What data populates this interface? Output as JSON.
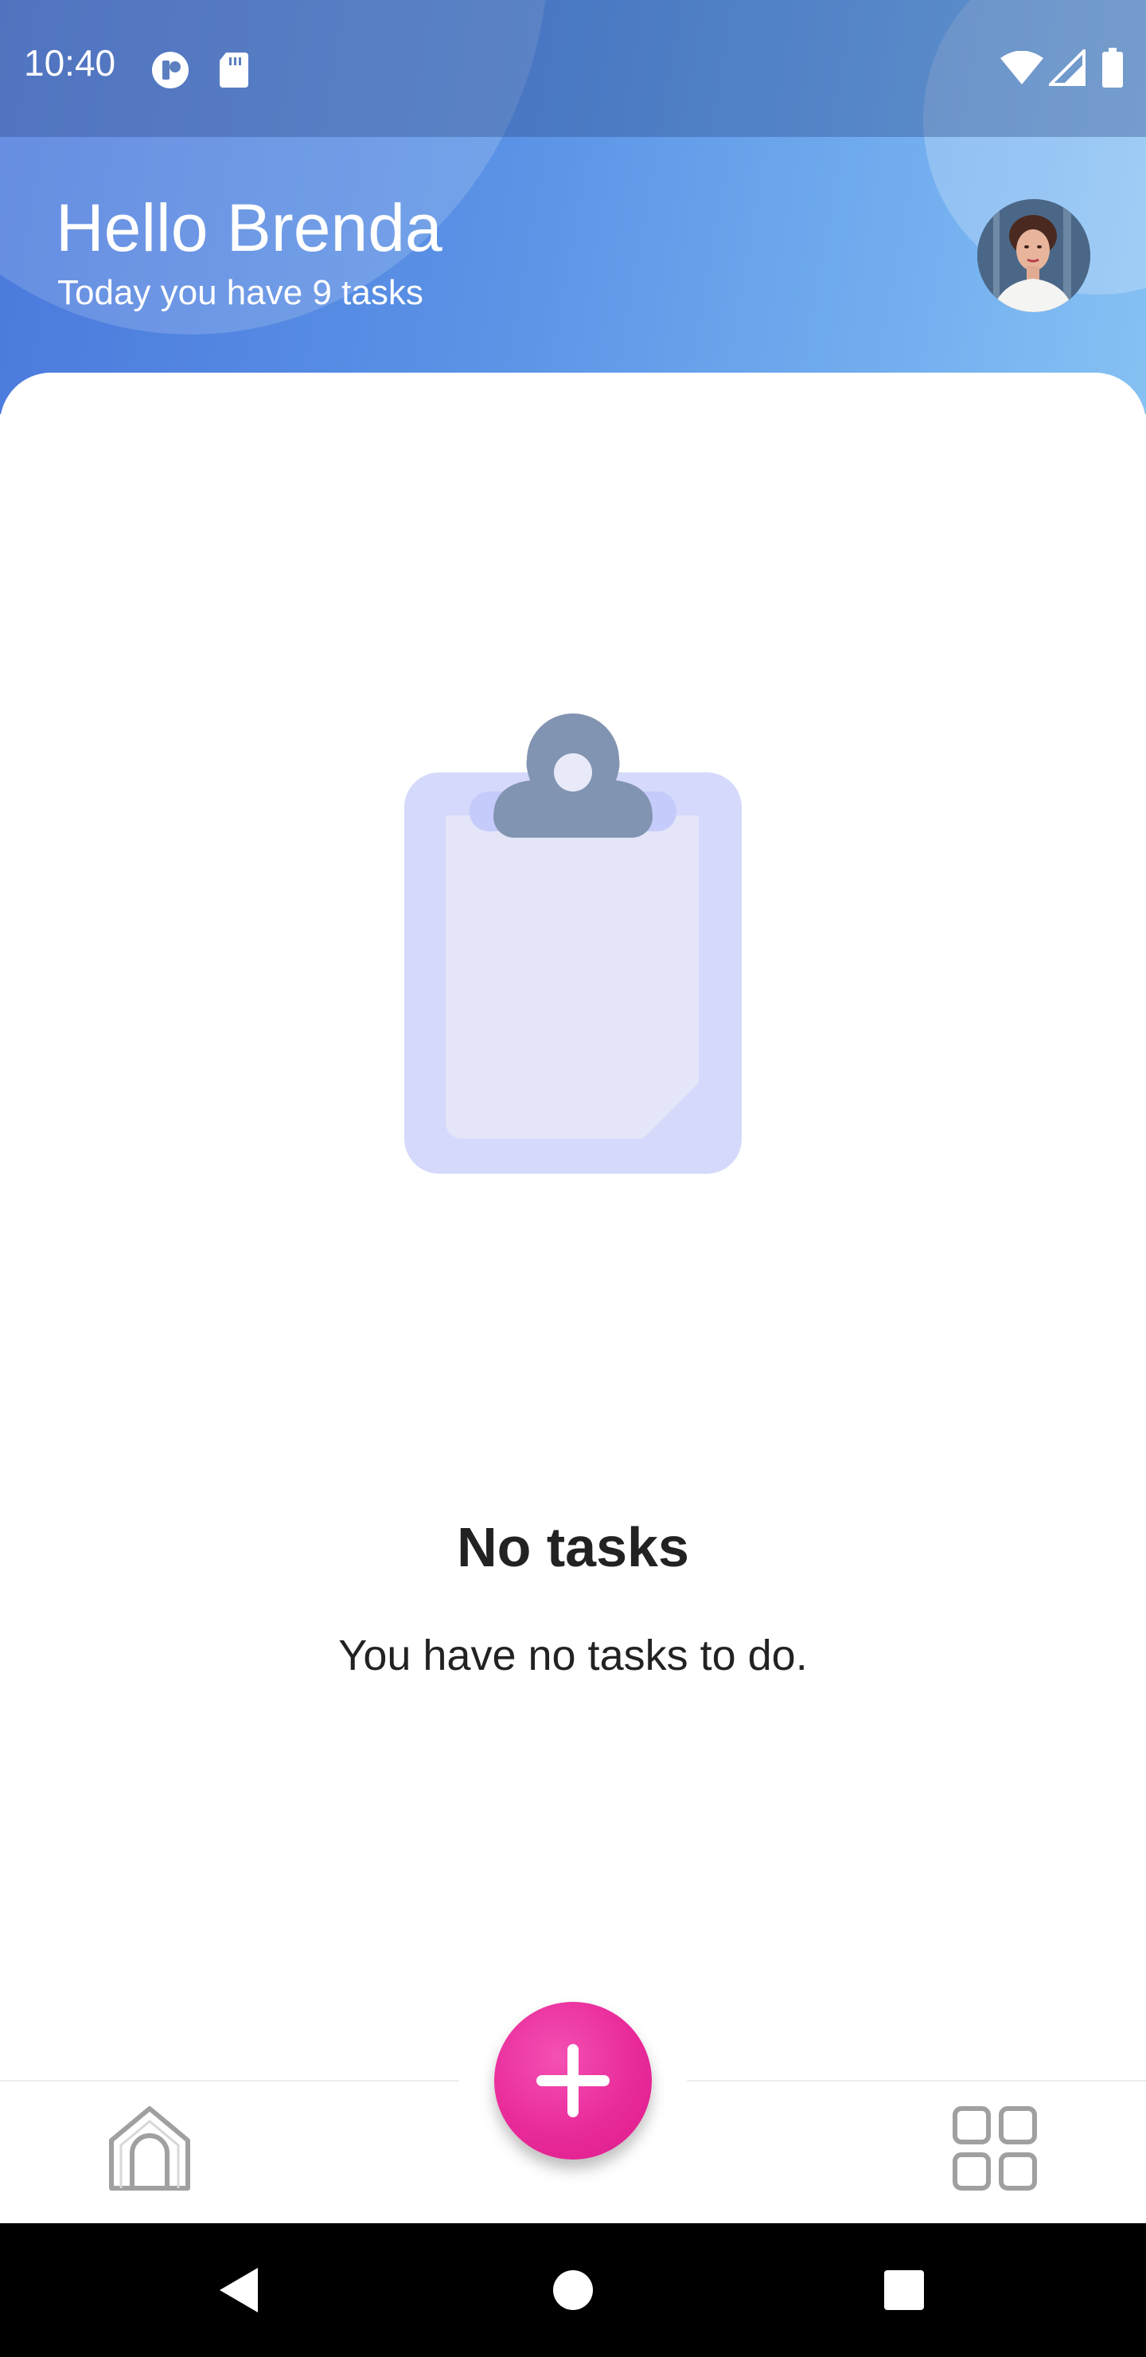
{
  "status_bar": {
    "time": "10:40",
    "icons": [
      "app-notification-icon",
      "sd-card-icon",
      "wifi-icon",
      "cellular-signal-icon",
      "battery-icon"
    ]
  },
  "header": {
    "greeting": "Hello Brenda",
    "subtitle": "Today you have 9 tasks",
    "avatar": "profile-avatar"
  },
  "empty_state": {
    "illustration": "clipboard-icon",
    "title": "No tasks",
    "message": "You have no tasks to do."
  },
  "bottom_nav": {
    "items": [
      {
        "name": "home",
        "icon": "home-icon"
      },
      {
        "name": "add",
        "icon": "plus-icon"
      },
      {
        "name": "dashboard",
        "icon": "grid-icon"
      }
    ]
  },
  "colors": {
    "header_gradient_start": "#4a78dc",
    "header_gradient_end": "#86c1f3",
    "fab": "#e92b9a",
    "clipboard_board": "#d5d9fb",
    "clipboard_clip": "#8194b1"
  }
}
